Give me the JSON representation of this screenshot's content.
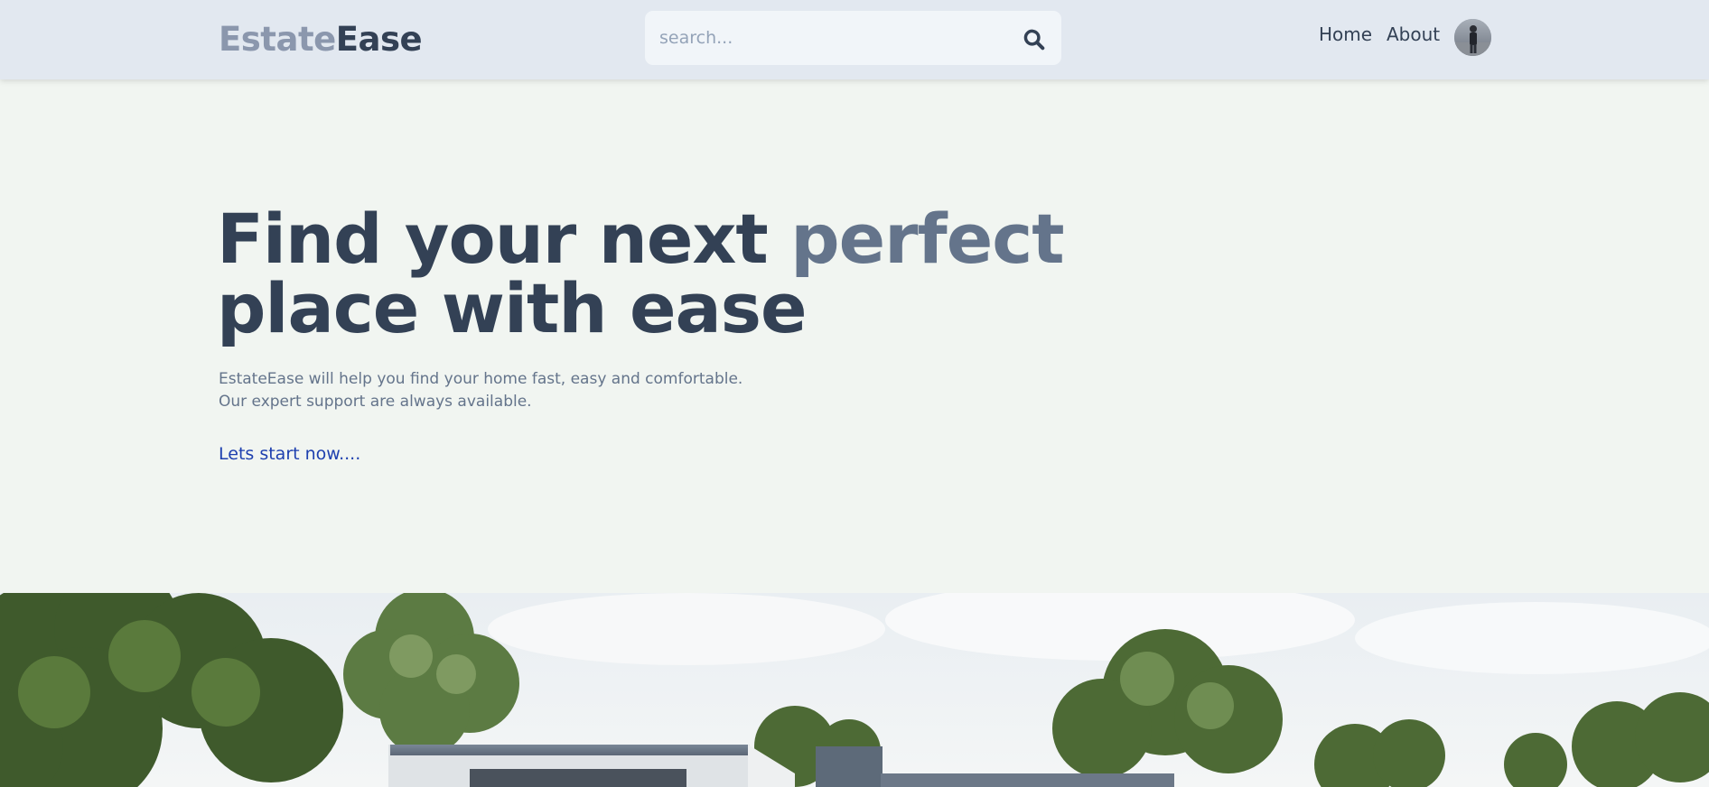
{
  "header": {
    "logo_part1": "Estate",
    "logo_part2": "Ease",
    "search_placeholder": "search...",
    "nav": {
      "home": "Home",
      "about": "About"
    }
  },
  "hero": {
    "title_line1_start": "Find your next ",
    "title_line1_accent": "perfect",
    "title_line2": "place with ease",
    "desc_line1": "EstateEase will help you find your home fast, easy and comfortable.",
    "desc_line2": "Our expert support are always available.",
    "cta": "Lets start now...."
  },
  "colors": {
    "header_bg": "#e2e8f0",
    "page_bg": "#f1f5f1",
    "text_dark": "#334155",
    "text_muted": "#64748b",
    "link": "#1e40af"
  },
  "icons": [
    "search-icon",
    "avatar"
  ]
}
